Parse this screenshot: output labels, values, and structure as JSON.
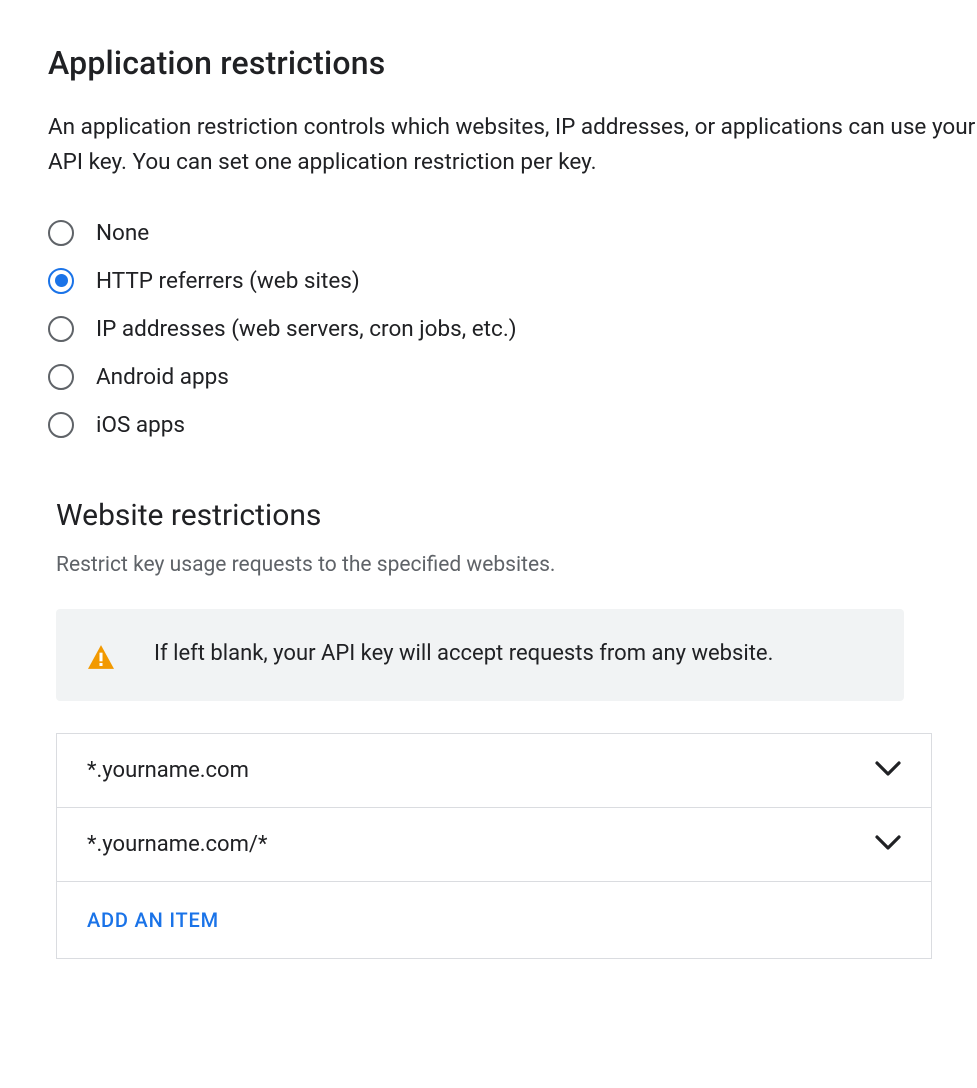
{
  "app_restrictions": {
    "title": "Application restrictions",
    "description": "An application restriction controls which websites, IP addresses, or applications can use your API key. You can set one application restriction per key.",
    "options": [
      {
        "label": "None",
        "selected": false
      },
      {
        "label": "HTTP referrers (web sites)",
        "selected": true
      },
      {
        "label": "IP addresses (web servers, cron jobs, etc.)",
        "selected": false
      },
      {
        "label": "Android apps",
        "selected": false
      },
      {
        "label": "iOS apps",
        "selected": false
      }
    ]
  },
  "website_restrictions": {
    "title": "Website restrictions",
    "description": "Restrict key usage requests to the specified websites.",
    "warning": "If left blank, your API key will accept requests from any website.",
    "items": [
      "*.yourname.com",
      "*.yourname.com/*"
    ],
    "add_label": "ADD AN ITEM"
  },
  "colors": {
    "accent": "#1a73e8",
    "warning": "#f29900"
  }
}
